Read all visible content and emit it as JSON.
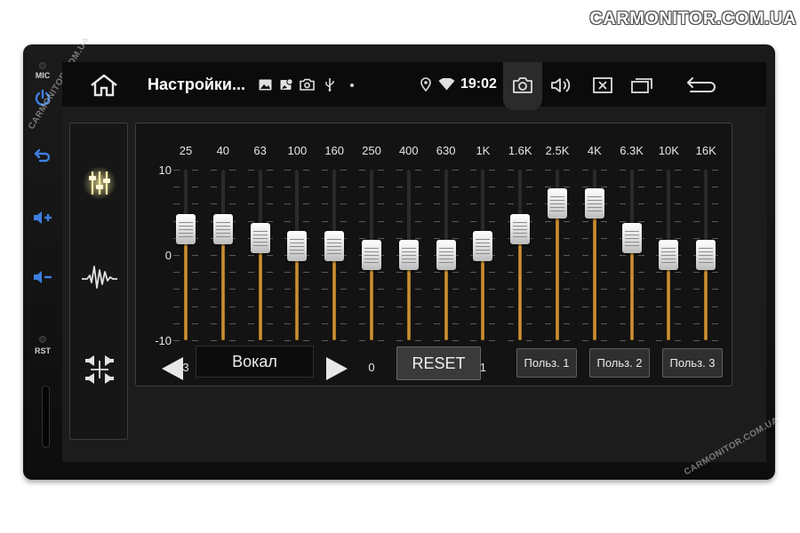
{
  "watermark": {
    "top": "CARMONITOR.COM.UA",
    "side": "CARMONITOR.COM.UA"
  },
  "hardware": {
    "mic_label": "MIC",
    "rst_label": "RST"
  },
  "statusbar": {
    "title": "Настройки...",
    "time": "19:02"
  },
  "equalizer": {
    "scale": {
      "top": "10",
      "mid": "0",
      "bottom": "-10",
      "range": [
        -10,
        10
      ]
    },
    "bands": [
      {
        "freq": "25",
        "gain": "3"
      },
      {
        "freq": "40",
        "gain": "3"
      },
      {
        "freq": "63",
        "gain": "2"
      },
      {
        "freq": "100",
        "gain": "1"
      },
      {
        "freq": "160",
        "gain": "1"
      },
      {
        "freq": "250",
        "gain": "0"
      },
      {
        "freq": "400",
        "gain": "0"
      },
      {
        "freq": "630",
        "gain": "0"
      },
      {
        "freq": "1K",
        "gain": "1"
      },
      {
        "freq": "1.6K",
        "gain": "3"
      },
      {
        "freq": "2.5K",
        "gain": "6"
      },
      {
        "freq": "4K",
        "gain": "6"
      },
      {
        "freq": "6.3K",
        "gain": "2"
      },
      {
        "freq": "10K",
        "gain": "0"
      },
      {
        "freq": "16K",
        "gain": "0"
      }
    ],
    "accent_color": "#d69b3a"
  },
  "presets": {
    "current": "Вокал",
    "reset_label": "RESET",
    "user_presets": [
      "Польз. 1",
      "Польз. 2",
      "Польз. 3"
    ]
  }
}
